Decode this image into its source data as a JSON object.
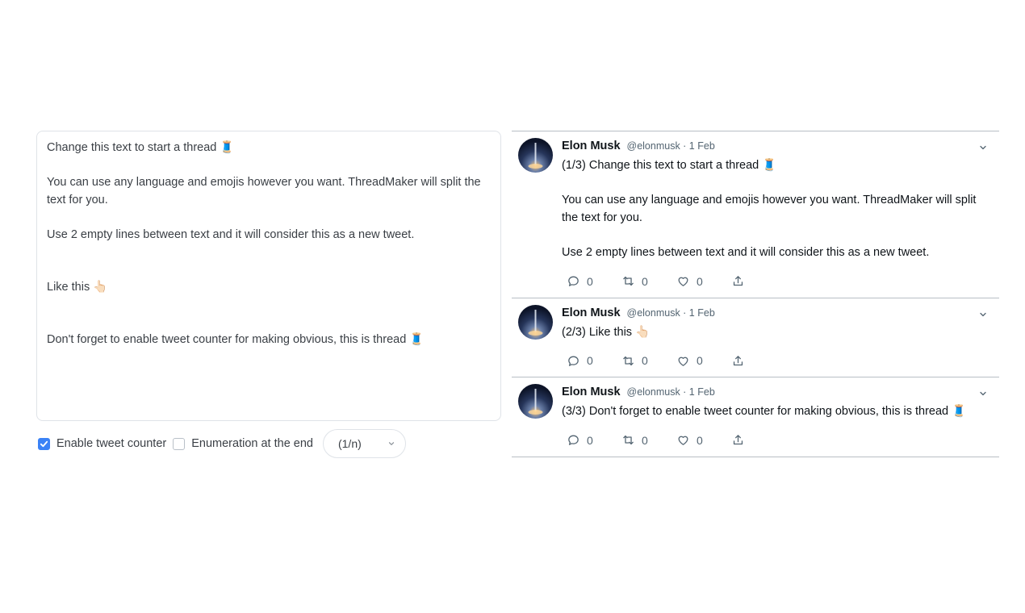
{
  "editor": {
    "text": "Change this text to start a thread 🧵\n\nYou can use any language and emojis however you want. ThreadMaker will split the text for you.\n\nUse 2 empty lines between text and it will consider this as a new tweet.\n\n\nLike this 👆🏻\n\n\nDon't forget to enable tweet counter for making obvious, this is thread 🧵"
  },
  "controls": {
    "tweet_counter_label": "Enable tweet counter",
    "tweet_counter_checked": true,
    "enumeration_label": "Enumeration at the end",
    "enumeration_checked": false,
    "format_value": "(1/n)"
  },
  "tweets": [
    {
      "author": "Elon Musk",
      "meta": "@elonmusk · 1 Feb",
      "text": "(1/3) Change this text to start a thread 🧵\n\nYou can use any language and emojis however you want. ThreadMaker will split the text for you.\n\nUse 2 empty lines between text and it will consider this as a new tweet.",
      "replies": "0",
      "retweets": "0",
      "likes": "0"
    },
    {
      "author": "Elon Musk",
      "meta": "@elonmusk · 1 Feb",
      "text": "(2/3) Like this 👆🏻",
      "replies": "0",
      "retweets": "0",
      "likes": "0"
    },
    {
      "author": "Elon Musk",
      "meta": "@elonmusk · 1 Feb",
      "text": "(3/3) Don't forget to enable tweet counter for making obvious, this is thread 🧵",
      "replies": "0",
      "retweets": "0",
      "likes": "0"
    }
  ],
  "icons": {
    "avatar": "rocket-launch-avatar",
    "reply": "reply-icon",
    "retweet": "retweet-icon",
    "like": "heart-icon",
    "share": "share-icon",
    "caret": "chevron-down-icon"
  },
  "colors": {
    "accent": "#3b82f6",
    "text_primary": "#0f1419",
    "text_secondary": "#536471"
  }
}
